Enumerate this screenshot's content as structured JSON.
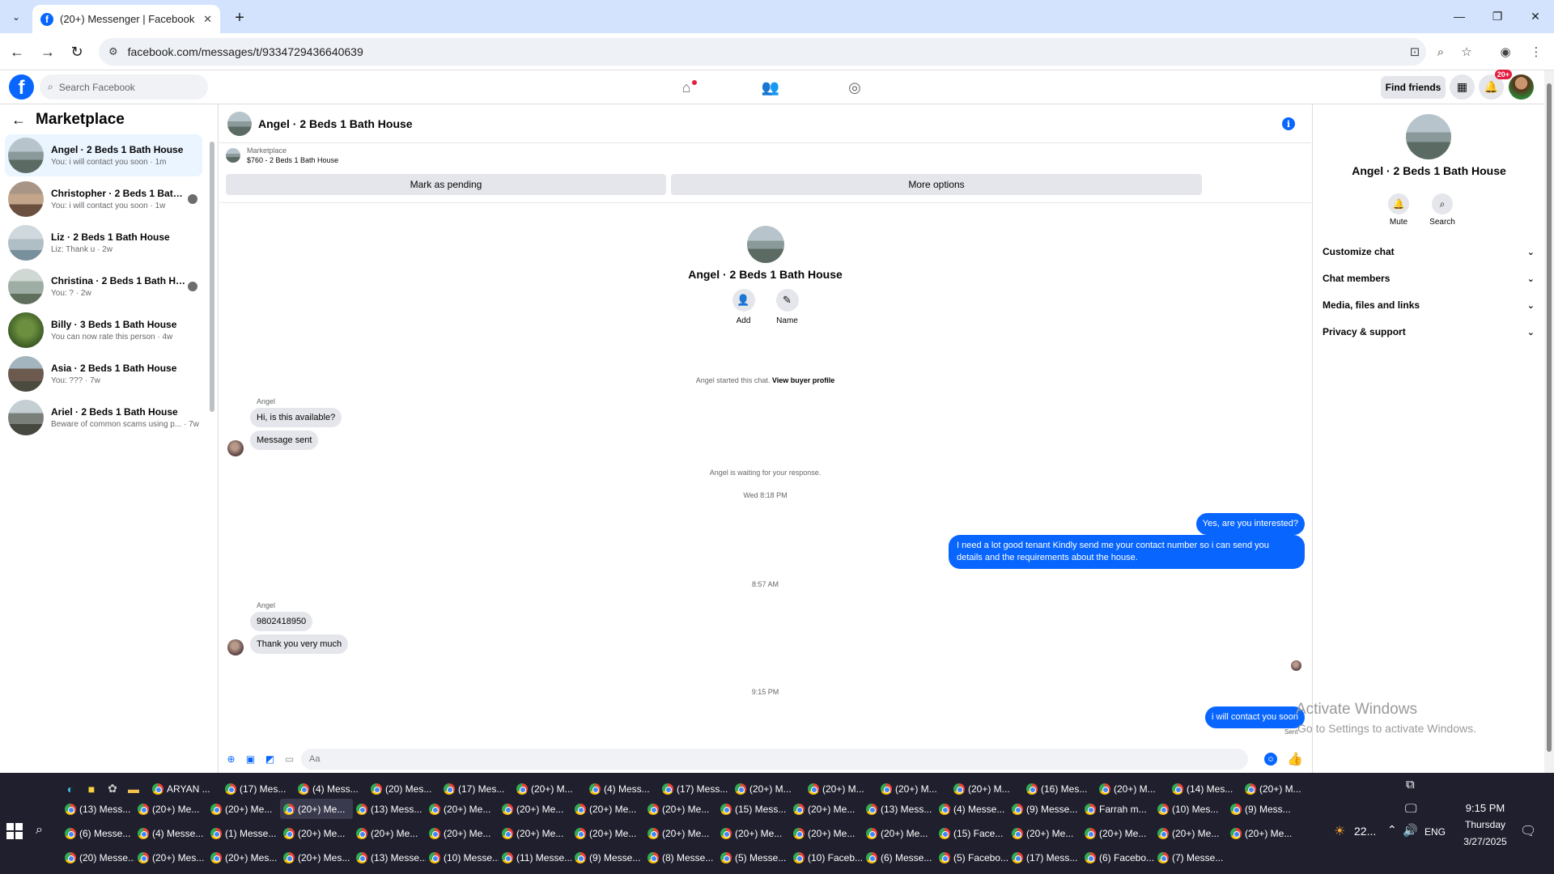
{
  "browser": {
    "tab_title": "(20+) Messenger | Facebook",
    "url": "facebook.com/messages/t/9334729436640639",
    "colors": {
      "tabbar": "#d3e3fd"
    }
  },
  "fb_header": {
    "search_placeholder": "Search Facebook",
    "find_friends": "Find friends",
    "notif_badge": "20+",
    "brand_color": "#0866ff"
  },
  "sidebar": {
    "title": "Marketplace",
    "conversations": [
      {
        "name": "Angel · 2 Beds 1 Bath House",
        "preview": "You: i will contact you soon · 1m",
        "active": true
      },
      {
        "name": "Christopher · 2 Beds 1 Bath H...",
        "preview": "You: i will contact you soon · 1w",
        "active": false
      },
      {
        "name": "Liz · 2 Beds 1 Bath House",
        "preview": "Liz: Thank u · 2w",
        "active": false
      },
      {
        "name": "Christina · 2 Beds 1 Bath House",
        "preview": "You: ? · 2w",
        "active": false
      },
      {
        "name": "Billy · 3 Beds 1 Bath House",
        "preview": "You can now rate this person · 4w",
        "active": false
      },
      {
        "name": "Asia · 2 Beds 1 Bath House",
        "preview": "You: ??? · 7w",
        "active": false
      },
      {
        "name": "Ariel · 2 Beds 1 Bath House",
        "preview": "Beware of common scams using p... · 7w",
        "active": false
      }
    ]
  },
  "chat": {
    "title": "Angel · 2 Beds 1 Bath House",
    "listing_label": "Marketplace",
    "listing_price": "$760 - 2 Beds 1 Bath House",
    "mark_pending": "Mark as pending",
    "more_options": "More options",
    "intro_name": "Angel · 2 Beds 1 Bath House",
    "add_label": "Add",
    "name_label": "Name",
    "started_text": "Angel started this chat.",
    "view_buyer": "View buyer profile",
    "sender_name": "Angel",
    "msg1": "Hi, is this available?",
    "msg2": "Message sent",
    "waiting_text": "Angel is waiting for your response.",
    "time1": "Wed 8:18 PM",
    "out1": "Yes, are you interested?",
    "out2": "I need a lot good tenant Kindly send me your contact number so i can send you details and the requirements about the house.",
    "time2": "8:57 AM",
    "sender_name2": "Angel",
    "msg3": "9802418950",
    "msg4": "Thank you very much",
    "time3": "9:15 PM",
    "out3": "i will contact you soon",
    "sent_label": "Sent",
    "composer_placeholder": "Aa"
  },
  "right_panel": {
    "name": "Angel · 2 Beds 1 Bath House",
    "mute": "Mute",
    "search": "Search",
    "rows": [
      "Customize chat",
      "Chat members",
      "Media, files and links",
      "Privacy & support"
    ]
  },
  "watermark": {
    "line1": "Activate Windows",
    "line2": "Go to Settings to activate Windows."
  },
  "taskbar": {
    "row1": [
      "ARYAN ...",
      "(17) Mes...",
      "(4) Mess...",
      "(20) Mes...",
      "(17) Mes...",
      "(20+) M...",
      "(4) Mess...",
      "(17) Mess...",
      "(20+) M...",
      "(20+) M...",
      "(20+) M...",
      "(20+) M...",
      "(16) Mes...",
      "(20+) M...",
      "(14) Mes...",
      "(20+) M..."
    ],
    "row2": [
      "(13) Mess...",
      "(20+) Me...",
      "(20+) Me...",
      "(20+) Me...",
      "(13) Mess...",
      "(20+) Me...",
      "(20+) Me...",
      "(20+) Me...",
      "(20+) Me...",
      "(15) Mess...",
      "(20+) Me...",
      "(13) Mess...",
      "(4) Messe...",
      "(9) Messe...",
      "Farrah m...",
      "(10) Mes...",
      "(9) Mess..."
    ],
    "row3": [
      "(6) Messe...",
      "(4) Messe...",
      "(1) Messe...",
      "(20+) Me...",
      "(20+) Me...",
      "(20+) Me...",
      "(20+) Me...",
      "(20+) Me...",
      "(20+) Me...",
      "(20+) Me...",
      "(20+) Me...",
      "(20+) Me...",
      "(15) Face...",
      "(20+) Me...",
      "(20+) Me...",
      "(20+) Me...",
      "(20+) Me..."
    ],
    "row4": [
      "(20) Messe...",
      "(20+) Mes...",
      "(20+) Mes...",
      "(20+) Mes...",
      "(13) Messe...",
      "(10) Messe...",
      "(11) Messe...",
      "(9) Messe...",
      "(8) Messe...",
      "(5) Messe...",
      "(10) Faceb...",
      "(6) Messe...",
      "(5) Facebo...",
      "(17) Mess...",
      "(6) Facebo...",
      "(7) Messe..."
    ],
    "weather": "22...",
    "lang": "ENG",
    "time": "9:15 PM",
    "day": "Thursday",
    "date": "3/27/2025"
  }
}
